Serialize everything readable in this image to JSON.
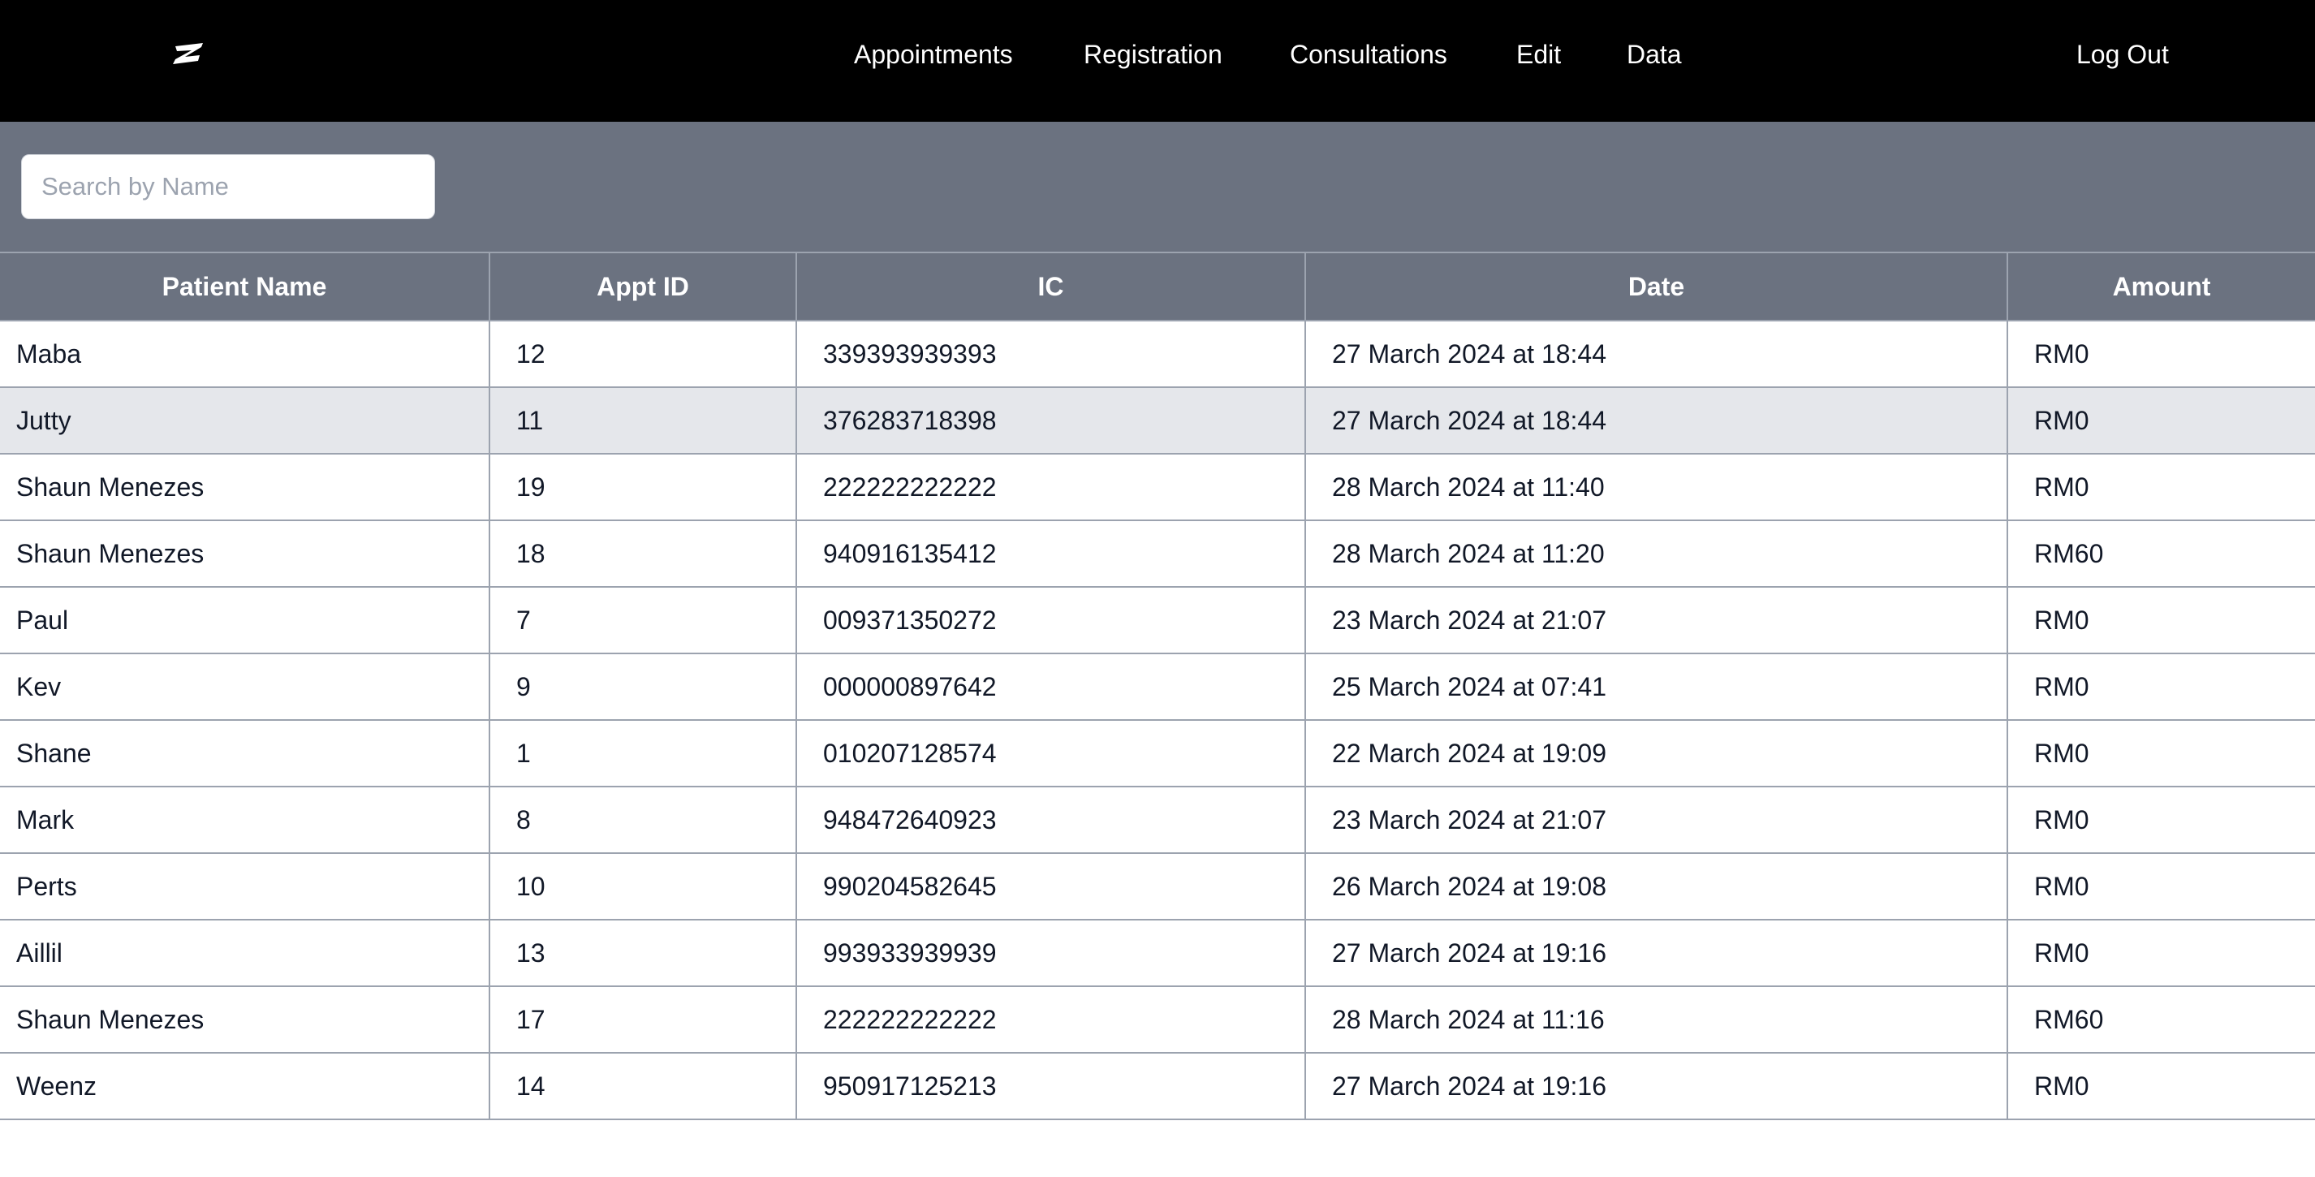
{
  "navbar": {
    "logo_icon": "zen-logo-icon",
    "links": [
      "Appointments",
      "Registration",
      "Consultations",
      "Edit",
      "Data"
    ],
    "logout_label": "Log Out"
  },
  "search": {
    "placeholder": "Search by Name",
    "value": ""
  },
  "table": {
    "headers": [
      "Patient Name",
      "Appt ID",
      "IC",
      "Date",
      "Amount"
    ],
    "rows": [
      [
        "Maba",
        "12",
        "339393939393",
        "27 March 2024 at 18:44",
        "RM0"
      ],
      [
        "Jutty",
        "11",
        "376283718398",
        "27 March 2024 at 18:44",
        "RM0"
      ],
      [
        "Shaun Menezes",
        "19",
        "222222222222",
        "28 March 2024 at 11:40",
        "RM0"
      ],
      [
        "Shaun Menezes",
        "18",
        "940916135412",
        "28 March 2024 at 11:20",
        "RM60"
      ],
      [
        "Paul",
        "7",
        "009371350272",
        "23 March 2024 at 21:07",
        "RM0"
      ],
      [
        "Kev",
        "9",
        "000000897642",
        "25 March 2024 at 07:41",
        "RM0"
      ],
      [
        "Shane",
        "1",
        "010207128574",
        "22 March 2024 at 19:09",
        "RM0"
      ],
      [
        "Mark",
        "8",
        "948472640923",
        "23 March 2024 at 21:07",
        "RM0"
      ],
      [
        "Perts",
        "10",
        "990204582645",
        "26 March 2024 at 19:08",
        "RM0"
      ],
      [
        "Aillil",
        "13",
        "993933939939",
        "27 March 2024 at 19:16",
        "RM0"
      ],
      [
        "Shaun Menezes",
        "17",
        "222222222222",
        "28 March 2024 at 11:16",
        "RM60"
      ],
      [
        "Weenz",
        "14",
        "950917125213",
        "27 March 2024 at 19:16",
        "RM0"
      ]
    ],
    "highlighted_row": 1
  },
  "colors": {
    "navbar_bg": "#000000",
    "toolbar_bg": "#6b7280",
    "row_highlight": "#e5e7eb",
    "border": "#9ca3af"
  }
}
